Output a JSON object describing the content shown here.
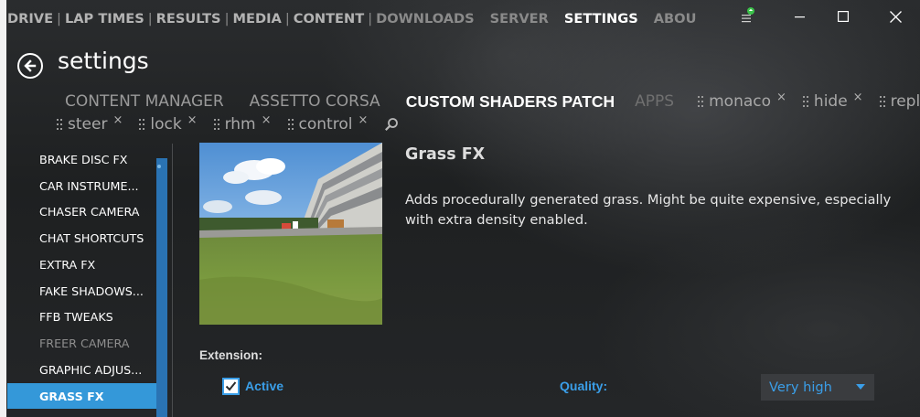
{
  "window": {
    "controls": {
      "menu_icon": "hamburger-with-green-badge-icon",
      "minimize_icon": "minimize-icon",
      "maximize_icon": "maximize-icon",
      "close_icon": "close-icon"
    }
  },
  "top_nav": {
    "tabs": [
      {
        "label": "DRIVE"
      },
      {
        "label": "LAP TIMES"
      },
      {
        "label": "RESULTS"
      },
      {
        "label": "MEDIA"
      },
      {
        "label": "CONTENT"
      },
      {
        "label": "DOWNLOADS"
      },
      {
        "label": "SERVER"
      },
      {
        "label": "SETTINGS"
      },
      {
        "label": "ABOU"
      }
    ],
    "active": "SETTINGS"
  },
  "header": {
    "title": "settings",
    "back_icon": "back-arrow-icon"
  },
  "sub_tabs": {
    "tabs": [
      {
        "label": "CONTENT MANAGER"
      },
      {
        "label": "ASSETTO CORSA"
      },
      {
        "label": "CUSTOM SHADERS PATCH"
      },
      {
        "label": "APPS"
      }
    ],
    "active": "CUSTOM SHADERS PATCH",
    "pinned_row1": [
      {
        "label": "monaco"
      },
      {
        "label": "hide"
      },
      {
        "label": "replay"
      }
    ],
    "pinned_row2": [
      {
        "label": "steer"
      },
      {
        "label": "lock"
      },
      {
        "label": "rhm"
      },
      {
        "label": "control"
      }
    ],
    "close_glyph": "×",
    "search_icon": "search-icon"
  },
  "sidebar": {
    "items": [
      {
        "label": "BRAKE DISC FX"
      },
      {
        "label": "CAR INSTRUME..."
      },
      {
        "label": "CHASER CAMERA"
      },
      {
        "label": "CHAT SHORTCUTS"
      },
      {
        "label": "EXTRA FX"
      },
      {
        "label": "FAKE SHADOWS..."
      },
      {
        "label": "FFB TWEAKS"
      },
      {
        "label": "FREER CAMERA"
      },
      {
        "label": "GRAPHIC ADJUS..."
      },
      {
        "label": "GRASS FX"
      }
    ],
    "selected": "GRASS FX",
    "disabled": "FREER CAMERA"
  },
  "detail": {
    "title": "Grass FX",
    "description": "Adds procedurally generated grass. Might be quite expensive, especially with extra density enabled.",
    "extension_label": "Extension:",
    "active_label": "Active",
    "active_checked": true,
    "quality_label": "Quality:",
    "quality_value": "Very high"
  },
  "colors": {
    "accent": "#3a9ee8",
    "selected_bg": "#3498d9",
    "select_bg": "#3a3c3f"
  }
}
